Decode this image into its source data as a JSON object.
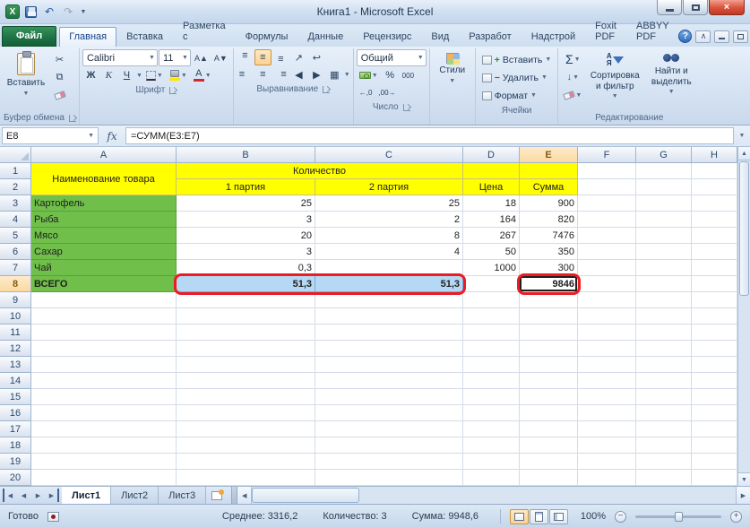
{
  "window": {
    "title": "Книга1  -  Microsoft Excel"
  },
  "icons": {
    "app": "X",
    "undo": "↶",
    "redo": "↷",
    "dropdown": "▼",
    "close": "×",
    "help": "?",
    "collapse_ribbon": "∧",
    "cut": "✂",
    "copy": "⧉",
    "bold": "Ж",
    "italic": "К",
    "underline": "Ч",
    "grow_font": "А▲",
    "shrink_font": "А▼",
    "font_color_letter": "А",
    "align_lines": "≡",
    "orientation": "↗",
    "wrap_text": "↩",
    "merge_center": "▦",
    "percent": "%",
    "thousands": "000",
    "increase_decimal": "←,0",
    "decrease_decimal": ",00→",
    "sigma": "Σ",
    "fill_down": "↓",
    "sort_a": "А",
    "sort_z": "Я",
    "fx": "fx",
    "nav_arrow_left": "◀",
    "nav_arrow_right": "▶",
    "scroll_up": "▲",
    "scroll_down": "▼",
    "zoom_out": "−",
    "zoom_in": "+"
  },
  "ribbon": {
    "tabs": [
      "Файл",
      "Главная",
      "Вставка",
      "Разметка с",
      "Формулы",
      "Данные",
      "Рецензирс",
      "Вид",
      "Разработ",
      "Надстрой",
      "Foxit PDF",
      "ABBYY PDF"
    ],
    "clipboard": {
      "paste": "Вставить",
      "label": "Буфер обмена"
    },
    "font": {
      "name": "Calibri",
      "size": "11",
      "label": "Шрифт"
    },
    "alignment": {
      "label": "Выравнивание"
    },
    "number": {
      "format": "Общий",
      "label": "Число"
    },
    "styles": {
      "button": "Стили"
    },
    "cells": {
      "insert": "Вставить",
      "delete": "Удалить",
      "format": "Формат",
      "label": "Ячейки"
    },
    "editing": {
      "sort": "Сортировка и фильтр",
      "find": "Найти и выделить",
      "label": "Редактирование"
    }
  },
  "formula_bar": {
    "name_box": "E8",
    "formula": "=СУММ(E3:E7)"
  },
  "grid": {
    "col_headers": [
      "A",
      "B",
      "C",
      "D",
      "E",
      "F",
      "G",
      "H"
    ],
    "rows_visible": 20,
    "selected_col_index": 4,
    "selected_row": 8,
    "cells": {
      "A1": {
        "text": "Наименование товара",
        "bg": "yellow",
        "rowspan": 2,
        "align": "center"
      },
      "B1": {
        "text": "Количество",
        "bg": "yellow",
        "colspan": 2,
        "align": "center"
      },
      "D1": {
        "bg": "yellow"
      },
      "E1": {
        "bg": "yellow"
      },
      "B2": {
        "text": "1 партия",
        "bg": "yellow",
        "align": "center"
      },
      "C2": {
        "text": "2 партия",
        "bg": "yellow",
        "align": "center"
      },
      "D2": {
        "text": "Цена",
        "bg": "yellow",
        "align": "center"
      },
      "E2": {
        "text": "Сумма",
        "bg": "yellow",
        "align": "center"
      },
      "A3": {
        "text": "Картофель",
        "bg": "green"
      },
      "B3": {
        "text": "25",
        "align": "right"
      },
      "C3": {
        "text": "25",
        "align": "right"
      },
      "D3": {
        "text": "18",
        "align": "right"
      },
      "E3": {
        "text": "900",
        "align": "right"
      },
      "A4": {
        "text": "Рыба",
        "bg": "green"
      },
      "B4": {
        "text": "3",
        "align": "right"
      },
      "C4": {
        "text": "2",
        "align": "right"
      },
      "D4": {
        "text": "164",
        "align": "right"
      },
      "E4": {
        "text": "820",
        "align": "right"
      },
      "A5": {
        "text": "Мясо",
        "bg": "green"
      },
      "B5": {
        "text": "20",
        "align": "right"
      },
      "C5": {
        "text": "8",
        "align": "right"
      },
      "D5": {
        "text": "267",
        "align": "right"
      },
      "E5": {
        "text": "7476",
        "align": "right"
      },
      "A6": {
        "text": "Сахар",
        "bg": "green"
      },
      "B6": {
        "text": "3",
        "align": "right"
      },
      "C6": {
        "text": "4",
        "align": "right"
      },
      "D6": {
        "text": "50",
        "align": "right"
      },
      "E6": {
        "text": "350",
        "align": "right"
      },
      "A7": {
        "text": "Чай",
        "bg": "green"
      },
      "B7": {
        "text": "0,3",
        "align": "right"
      },
      "D7": {
        "text": "1000",
        "align": "right"
      },
      "E7": {
        "text": "300",
        "align": "right"
      },
      "A8": {
        "text": "ВСЕГО",
        "bg": "green",
        "bold": true
      },
      "B8": {
        "text": "51,3",
        "bg": "blue",
        "align": "right",
        "bold": true
      },
      "C8": {
        "text": "51,3",
        "bg": "blue",
        "align": "right",
        "bold": true
      },
      "D8": {},
      "E8": {
        "text": "9846",
        "align": "right",
        "bold": true,
        "active": true
      }
    },
    "annotation_color": "#ec1c24"
  },
  "sheet_tabs": {
    "tabs": [
      "Лист1",
      "Лист2",
      "Лист3"
    ]
  },
  "status_bar": {
    "ready": "Готово",
    "average": "Среднее: 3316,2",
    "count": "Количество: 3",
    "sum": "Сумма: 9948,6",
    "zoom": "100%"
  }
}
